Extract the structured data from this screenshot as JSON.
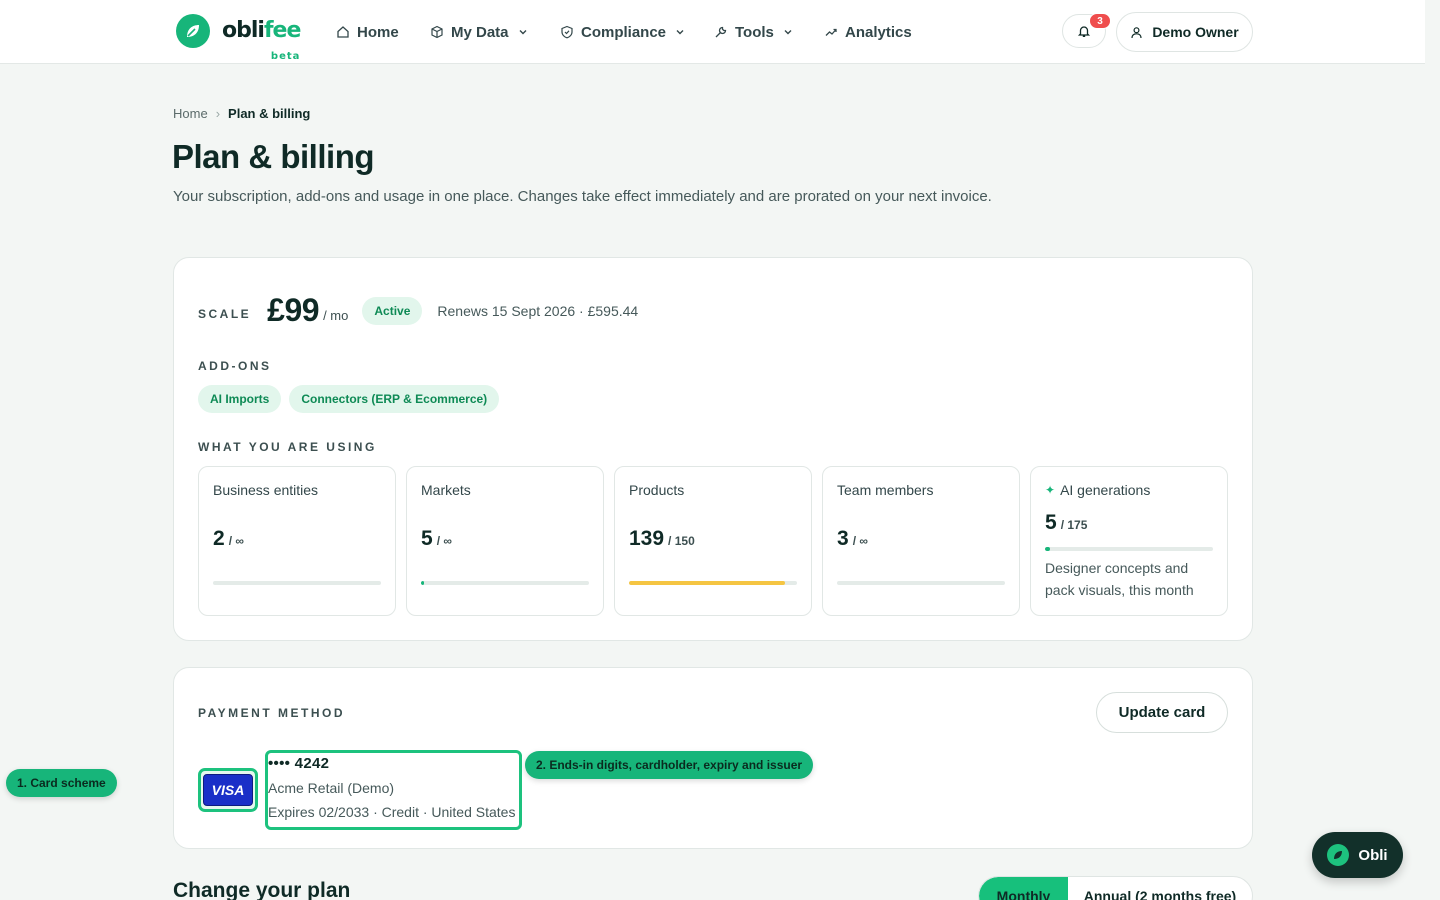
{
  "brand": {
    "name_main": "obli",
    "name_accent": "fee",
    "badge": "beta",
    "accent_color": "#17b57a"
  },
  "nav": {
    "home": "Home",
    "my_data": "My Data",
    "compliance": "Compliance",
    "tools": "Tools",
    "analytics": "Analytics"
  },
  "notifications": {
    "count": "3",
    "icon": "bell-icon"
  },
  "user": {
    "name": "Demo Owner",
    "icon": "user-icon"
  },
  "breadcrumb": {
    "home": "Home",
    "separator": "›",
    "current": "Plan & billing"
  },
  "page": {
    "title": "Plan & billing",
    "subtitle": "Your subscription, add-ons and usage in one place. Changes take effect immediately and are prorated on your next invoice."
  },
  "plan": {
    "name": "SCALE",
    "price": "£99",
    "period": "/ mo",
    "status": "Active",
    "renewal": "Renews 15 Sept 2026 · £595.44"
  },
  "addons": {
    "label": "ADD-ONS",
    "items": [
      "AI Imports",
      "Connectors (ERP & Ecommerce)"
    ]
  },
  "usage": {
    "label": "WHAT YOU ARE USING",
    "items": [
      {
        "label": "Business entities",
        "used": "2",
        "limit": "/ ∞",
        "fraction": 0,
        "bar_color": "#e4ebe8"
      },
      {
        "label": "Markets",
        "used": "5",
        "limit": "/ ∞",
        "fraction": 0.01,
        "bar_color": "#17b57a"
      },
      {
        "label": "Products",
        "used": "139",
        "limit": "/ 150",
        "fraction": 0.93,
        "bar_color": "#f5c542"
      },
      {
        "label": "Team members",
        "used": "3",
        "limit": "/ ∞",
        "fraction": 0,
        "bar_color": "#e4ebe8"
      }
    ],
    "ai": {
      "icon": "✦",
      "label": "AI generations",
      "used": "5",
      "limit": "/ 175",
      "fraction": 0.03,
      "bar_color": "#17b57a",
      "note": "Designer concepts and pack visuals, this month"
    }
  },
  "payment": {
    "label": "PAYMENT METHOD",
    "update_button": "Update card",
    "scheme": "VISA",
    "number": "•••• 4242",
    "holder": "Acme Retail (Demo)",
    "meta": "Expires 02/2033 · Credit · United States"
  },
  "callouts": {
    "one": "1. Card scheme",
    "two": "2. Ends-in digits, cardholder, expiry and issuer"
  },
  "change_plan": {
    "title": "Change your plan",
    "billing_toggle": {
      "monthly": "Monthly",
      "annual": "Annual (2 months free)"
    }
  },
  "assistant": {
    "label": "Obli"
  }
}
